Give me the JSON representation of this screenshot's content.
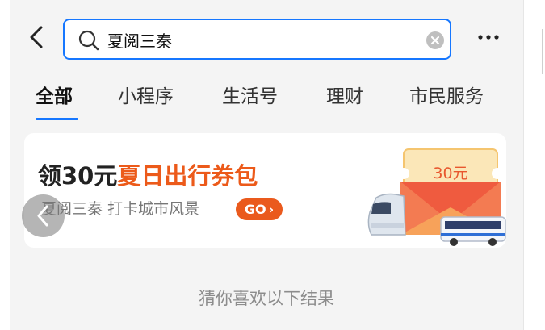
{
  "header": {
    "search_value": "夏阅三秦"
  },
  "tabs": [
    {
      "label": "全部",
      "active": true
    },
    {
      "label": "小程序",
      "active": false
    },
    {
      "label": "生活号",
      "active": false
    },
    {
      "label": "理财",
      "active": false
    },
    {
      "label": "市民服务",
      "active": false
    }
  ],
  "banner": {
    "title_prefix": "领30元",
    "title_highlight": "夏日出行券包",
    "subtitle": "夏阅三秦 打卡城市风景",
    "go_label": "GO",
    "coupon_amount": "30元"
  },
  "results_hint": "猜你喜欢以下结果",
  "colors": {
    "accent": "#1677ff",
    "highlight": "#ec5a1a",
    "go_button": "#ea5a1d"
  },
  "icons": {
    "back": "chevron-left-icon",
    "search": "search-icon",
    "clear": "clear-icon",
    "more": "more-icon",
    "scroll_left": "arrow-left-icon"
  }
}
